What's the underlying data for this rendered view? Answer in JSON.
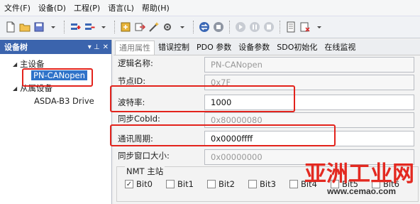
{
  "menu": [
    "文件(F)",
    "设备(D)",
    "工程(P)",
    "语言(L)",
    "帮助(H)"
  ],
  "toolbar": {
    "icons": [
      "new-file-icon",
      "open-folder-icon",
      "save-icon",
      "save-dropdown-icon",
      "add-device-icon",
      "remove-device-icon",
      "import-icon",
      "export-icon",
      "wand-icon",
      "gear-dropdown-icon",
      "connect-icon",
      "stop-icon",
      "run-icon",
      "pause-icon",
      "step-icon",
      "document-icon",
      "clear-icon",
      "dropdown-icon"
    ]
  },
  "tree": {
    "title": "设备树",
    "header_icons": [
      "▾ ⊥",
      "✕"
    ],
    "items": [
      {
        "label": "主设备",
        "expanded": true
      },
      {
        "label": "PN-CANopen",
        "selected": true
      },
      {
        "label": "从属设备",
        "expanded": true
      },
      {
        "label": "ASDA-B3 Drive"
      }
    ]
  },
  "tabs": [
    "通用属性",
    "错误控制",
    "PDO 参数",
    "设备参数",
    "SDO初始化",
    "在线监视"
  ],
  "properties": [
    {
      "label": "逻辑名称:",
      "value": "PN-CANopen",
      "editable": false
    },
    {
      "label": "节点ID:",
      "value": "0x7F",
      "editable": false
    },
    {
      "label": "波特率:",
      "value": "1000",
      "editable": true
    },
    {
      "label": "同步CobId:",
      "value": "0x80000080",
      "editable": false
    },
    {
      "label": "通讯周期:",
      "value": "0x0000ffff",
      "editable": true
    },
    {
      "label": "同步窗口大小:",
      "value": "0x00000000",
      "editable": false
    }
  ],
  "nmt": {
    "title": "NMT 主站",
    "bits": [
      {
        "label": "Bit0",
        "checked": true
      },
      {
        "label": "Bit1",
        "checked": false
      },
      {
        "label": "Bit2",
        "checked": false
      },
      {
        "label": "Bit3",
        "checked": false
      },
      {
        "label": "Bit4",
        "checked": false
      },
      {
        "label": "Bit5",
        "checked": false
      },
      {
        "label": "Bit6",
        "checked": false
      }
    ]
  },
  "watermark": {
    "text": "亚洲工业网",
    "url": "www.cemao.com"
  },
  "colors": {
    "highlight_red": "#e3231c",
    "tree_header": "#3b64ad",
    "selection": "#2f73c9"
  }
}
